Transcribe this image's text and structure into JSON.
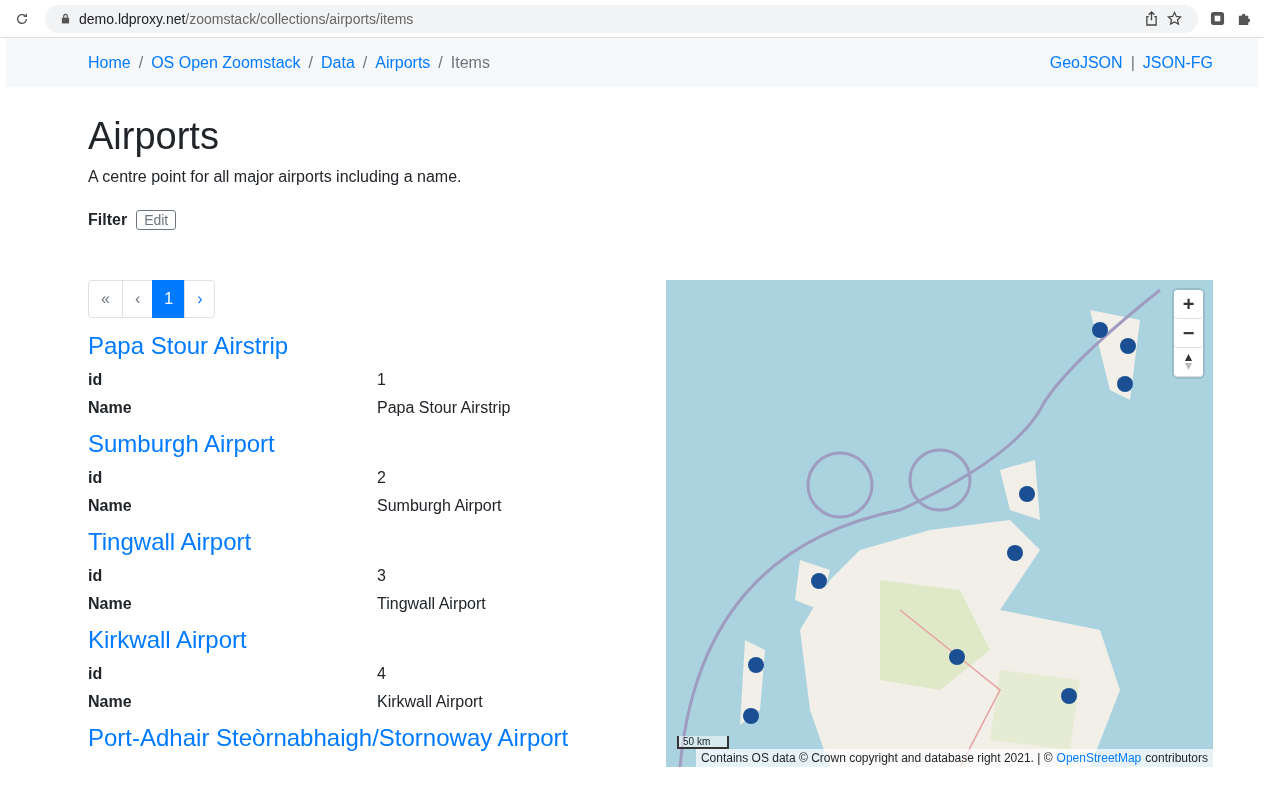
{
  "browser": {
    "url_host": "demo.ldproxy.net",
    "url_path": "/zoomstack/collections/airports/items"
  },
  "breadcrumb": [
    {
      "label": "Home",
      "current": false
    },
    {
      "label": "OS Open Zoomstack",
      "current": false
    },
    {
      "label": "Data",
      "current": false
    },
    {
      "label": "Airports",
      "current": false
    },
    {
      "label": "Items",
      "current": true
    }
  ],
  "breadcrumb_separator": "/",
  "formats": [
    "GeoJSON",
    "JSON-FG"
  ],
  "format_separator": "|",
  "title": "Airports",
  "description": "A centre point for all major airports including a name.",
  "filter": {
    "label": "Filter",
    "button": "Edit"
  },
  "pagination": [
    {
      "label": "«",
      "selected": false,
      "disabled": true
    },
    {
      "label": "‹",
      "selected": false,
      "disabled": true
    },
    {
      "label": "1",
      "selected": true,
      "disabled": false
    },
    {
      "label": "›",
      "selected": false,
      "disabled": false
    }
  ],
  "features": [
    {
      "title": "Papa Stour Airstrip",
      "properties": [
        {
          "key": "id",
          "value": "1"
        },
        {
          "key": "Name",
          "value": "Papa Stour Airstrip"
        }
      ]
    },
    {
      "title": "Sumburgh Airport",
      "properties": [
        {
          "key": "id",
          "value": "2"
        },
        {
          "key": "Name",
          "value": "Sumburgh Airport"
        }
      ]
    },
    {
      "title": "Tingwall Airport",
      "properties": [
        {
          "key": "id",
          "value": "3"
        },
        {
          "key": "Name",
          "value": "Tingwall Airport"
        }
      ]
    },
    {
      "title": "Kirkwall Airport",
      "properties": [
        {
          "key": "id",
          "value": "4"
        },
        {
          "key": "Name",
          "value": "Kirkwall Airport"
        }
      ]
    },
    {
      "title": "Port-Adhair Steòrnabhaigh/Stornoway Airport"
    }
  ],
  "map": {
    "kind": "picture",
    "zoom_in": "+",
    "zoom_out": "−",
    "scale": "50 km",
    "attribution": "Contains OS data © Crown copyright and database right 2021. | ©",
    "attribution_link": "OpenStreetMap",
    "attribution_end": "contributors"
  }
}
